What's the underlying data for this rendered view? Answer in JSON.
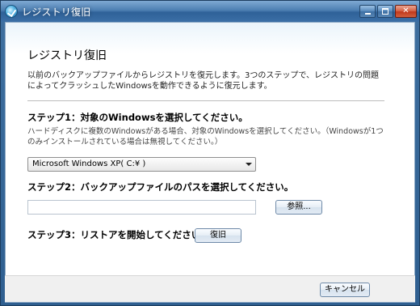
{
  "window": {
    "title": "レジストリ復旧",
    "icon": "restore-check-icon",
    "controls": [
      "minimize-icon",
      "maximize-icon",
      "close-icon"
    ]
  },
  "main": {
    "heading": "レジストリ復旧",
    "description": "以前のバックアップファイルからレジストリを復元します。3つのステップで、レジストリの問題によってクラッシュしたWindowsを動作できるように復元します。",
    "step1": {
      "label": "ステップ1：対象のWindowsを選択してください。",
      "hint": "ハードディスクに複数のWindowsがある場合、対象のWindowsを選択してください。（Windowsが1つのみインストールされている場合は無視してください。）",
      "selected": "Microsoft Windows XP( C:¥ )"
    },
    "step2": {
      "label": "ステップ2：バックアップファイルのパスを選択してください。",
      "path_value": "",
      "browse_label": "参照..."
    },
    "step3": {
      "label": "ステップ3：リストアを開始してください。",
      "restore_label": "復旧"
    }
  },
  "footer": {
    "cancel_label": "キャンセル"
  },
  "colors": {
    "titlebar": "#3b6fa6",
    "footer": "#f0f0f0",
    "separator": "#bcbcbc"
  }
}
